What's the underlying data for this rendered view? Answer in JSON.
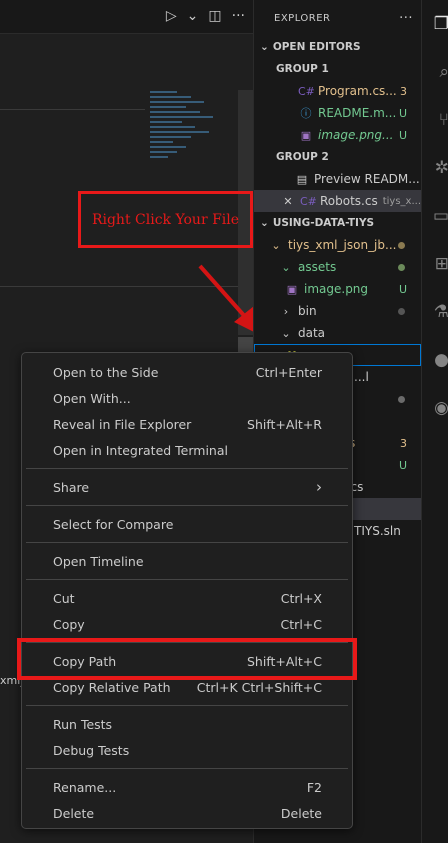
{
  "explorer": {
    "title": "EXPLORER",
    "more": "···",
    "open_editors": {
      "label": "OPEN EDITORS",
      "group1": "GROUP 1",
      "group1_items": [
        {
          "icon": "C#",
          "name": "Program.cs...",
          "badge": "3"
        },
        {
          "icon": "ⓘ",
          "name": "README.m...",
          "badge": "U"
        },
        {
          "icon": "▣",
          "name": "image.png...",
          "badge": "U"
        }
      ],
      "group2": "GROUP 2",
      "group2_items": [
        {
          "icon": "▤",
          "name": "Preview READM..."
        },
        {
          "close": "✕",
          "icon": "C#",
          "name": "Robots.cs",
          "path": "tiys_x..."
        }
      ]
    },
    "workspace": {
      "label": "USING-DATA-TIYS",
      "project": "tiys_xml_json_jb...",
      "assets": "assets",
      "image": "image.png",
      "image_badge": "U",
      "bin": "bin",
      "data": "data",
      "file_json": "...n",
      "partial_rows": [
        "...l",
        "",
        ")",
        "s",
        "nd",
        "t.cs"
      ],
      "badge_3": "3",
      "badge_u": "U",
      "sln": "TIYS.sln"
    }
  },
  "annotation": {
    "text": "Right Click Your File"
  },
  "menu": {
    "groups": [
      [
        {
          "label": "Open to the Side",
          "kb": "Ctrl+Enter"
        },
        {
          "label": "Open With...",
          "kb": ""
        },
        {
          "label": "Reveal in File Explorer",
          "kb": "Shift+Alt+R"
        },
        {
          "label": "Open in Integrated Terminal",
          "kb": ""
        }
      ],
      [
        {
          "label": "Share",
          "kb": "›"
        }
      ],
      [
        {
          "label": "Select for Compare",
          "kb": ""
        }
      ],
      [
        {
          "label": "Open Timeline",
          "kb": ""
        }
      ],
      [
        {
          "label": "Cut",
          "kb": "Ctrl+X"
        },
        {
          "label": "Copy",
          "kb": "Ctrl+C"
        }
      ],
      [
        {
          "label": "Copy Path",
          "kb": "Shift+Alt+C"
        },
        {
          "label": "Copy Relative Path",
          "kb": "Ctrl+K Ctrl+Shift+C"
        }
      ],
      [
        {
          "label": "Run Tests",
          "kb": ""
        },
        {
          "label": "Debug Tests",
          "kb": ""
        }
      ],
      [
        {
          "label": "Rename...",
          "kb": "F2"
        },
        {
          "label": "Delete",
          "kb": "Delete"
        }
      ]
    ]
  },
  "editor": {
    "run_icon": "▷",
    "split_icon": "◫",
    "more": "···",
    "partial_tab": "xml_"
  }
}
